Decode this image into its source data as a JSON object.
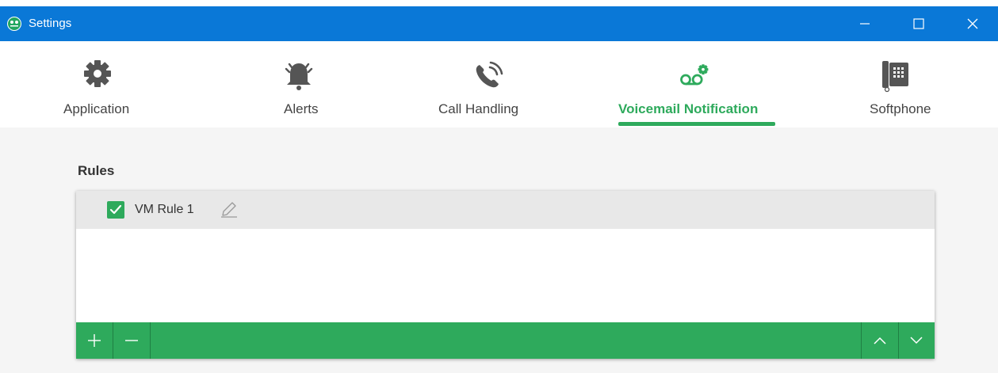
{
  "window": {
    "title": "Settings",
    "controls": [
      "minimize",
      "maximize",
      "close"
    ],
    "titlebar_color": "#0a78d7"
  },
  "tabs": [
    {
      "label": "Application",
      "icon": "gear-icon",
      "active": false
    },
    {
      "label": "Alerts",
      "icon": "bell-icon",
      "active": false
    },
    {
      "label": "Call Handling",
      "icon": "phone-ringing-icon",
      "active": false
    },
    {
      "label": "Voicemail Notification",
      "icon": "voicemail-gear-icon",
      "active": true
    },
    {
      "label": "Softphone",
      "icon": "desk-phone-icon",
      "active": false
    }
  ],
  "rules": {
    "section_label": "Rules",
    "items": [
      {
        "name": "VM Rule 1",
        "enabled": true
      }
    ],
    "toolbar": {
      "add_symbol": "+",
      "remove_symbol": "—",
      "up_icon": "chevron-up-icon",
      "down_icon": "chevron-down-icon"
    }
  },
  "colors": {
    "accent": "#2eaa5c",
    "selected_row": "#e8e8e8",
    "content_bg": "#f5f5f5"
  }
}
